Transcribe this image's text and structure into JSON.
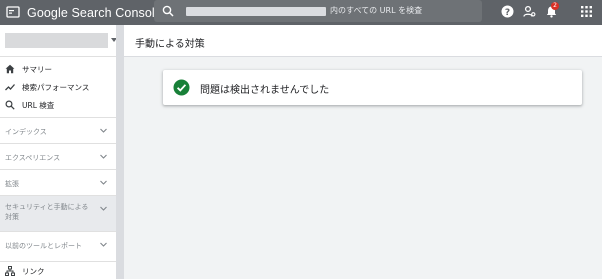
{
  "app": {
    "title": "Google Search Console"
  },
  "search": {
    "placeholder": "内のすべての URL を検査"
  },
  "topbar": {
    "notification_count": "2",
    "icons": [
      "help-icon",
      "account-settings-icon",
      "notifications-icon",
      "apps-grid-icon"
    ]
  },
  "sidebar": {
    "items": [
      {
        "label": "サマリー",
        "icon": "home-icon"
      },
      {
        "label": "検索パフォーマンス",
        "icon": "trend-icon"
      },
      {
        "label": "URL 検査",
        "icon": "search-icon"
      }
    ],
    "sections": [
      {
        "label": "インデックス"
      },
      {
        "label": "エクスペリエンス"
      },
      {
        "label": "拡張"
      },
      {
        "label": "セキュリティと手動による対策"
      },
      {
        "label": "以前のツールとレポート"
      }
    ],
    "bottom_item": {
      "label": "リンク",
      "icon": "links-icon"
    }
  },
  "main": {
    "title": "手動による対策",
    "status_message": "問題は検出されませんでした"
  },
  "colors": {
    "topbar": "#5f6368",
    "success": "#188038",
    "badge": "#d93025"
  }
}
